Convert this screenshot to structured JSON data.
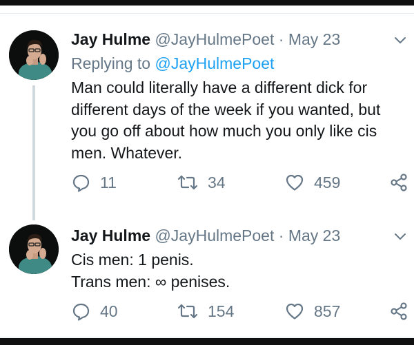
{
  "tweets": [
    {
      "author_name": "Jay Hulme",
      "handle": "@JayHulmePoet",
      "separator": "·",
      "date": "May 23",
      "reply_prefix": "Replying to",
      "reply_handle": "@JayHulmePoet",
      "text_lines": [
        "Man could literally have a different dick for",
        "different days of the week if you wanted, but",
        "you go off about how much you only like cis",
        "men. Whatever."
      ],
      "replies": "11",
      "retweets": "34",
      "likes": "459"
    },
    {
      "author_name": "Jay Hulme",
      "handle": "@JayHulmePoet",
      "separator": "·",
      "date": "May 23",
      "text_lines": [
        "Cis men: 1 penis.",
        "Trans men: ∞ penises."
      ],
      "replies": "40",
      "retweets": "154",
      "likes": "857"
    }
  ],
  "icons": {
    "reply": "reply-icon",
    "retweet": "retweet-icon",
    "like": "heart-icon",
    "share": "share-icon",
    "menu": "chevron-down-icon"
  },
  "colors": {
    "text": "#14171a",
    "muted": "#657786",
    "link": "#1da1f2",
    "thread_line": "#cfd9de"
  }
}
